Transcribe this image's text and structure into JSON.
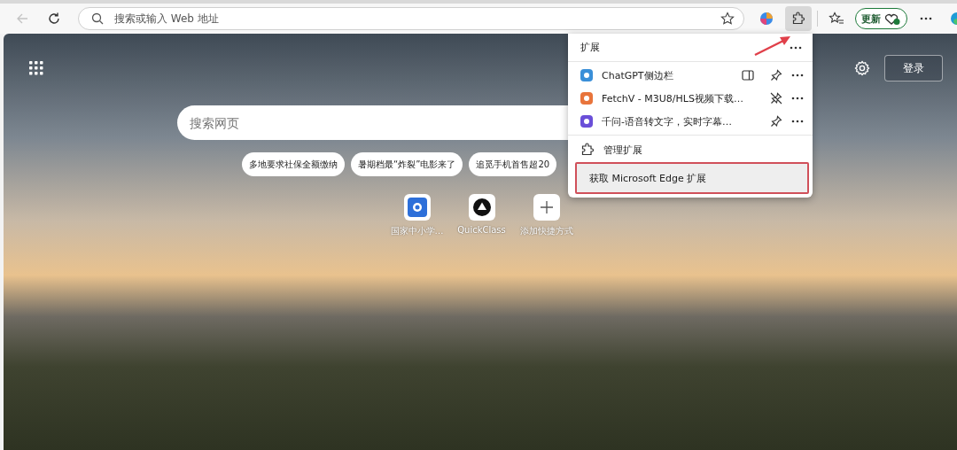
{
  "toolbar": {
    "back_disabled": true,
    "address": {
      "placeholder": "搜索或输入 Web 地址"
    },
    "extensions_button_active": true,
    "update_button": {
      "label": "更新"
    }
  },
  "new_tab": {
    "search": {
      "placeholder": "搜索网页"
    },
    "trending": [
      "多地要求社保全额缴纳",
      "暑期档最“炸裂”电影来了",
      "追觅手机首售超20"
    ],
    "quick_links": [
      {
        "label": "国家中小学…",
        "kind": "site"
      },
      {
        "label": "QuickClass",
        "kind": "app"
      },
      {
        "label": "添加快捷方式",
        "kind": "add"
      }
    ],
    "login_button": "登录"
  },
  "extensions_menu": {
    "title": "扩展",
    "items": [
      {
        "name": "ChatGPT侧边栏",
        "sidebar": true,
        "pinned": false,
        "color": "#3a8fd8"
      },
      {
        "name": "FetchV - M3U8/HLS视频下载…",
        "sidebar": false,
        "pinned": true,
        "color": "#e8743b"
      },
      {
        "name": "千问-语音转文字，实时字幕…",
        "sidebar": false,
        "pinned": false,
        "color": "#6a4fd8"
      }
    ],
    "manage": "管理扩展",
    "get": {
      "label": "获取 Microsoft Edge 扩展",
      "highlighted": true
    }
  }
}
